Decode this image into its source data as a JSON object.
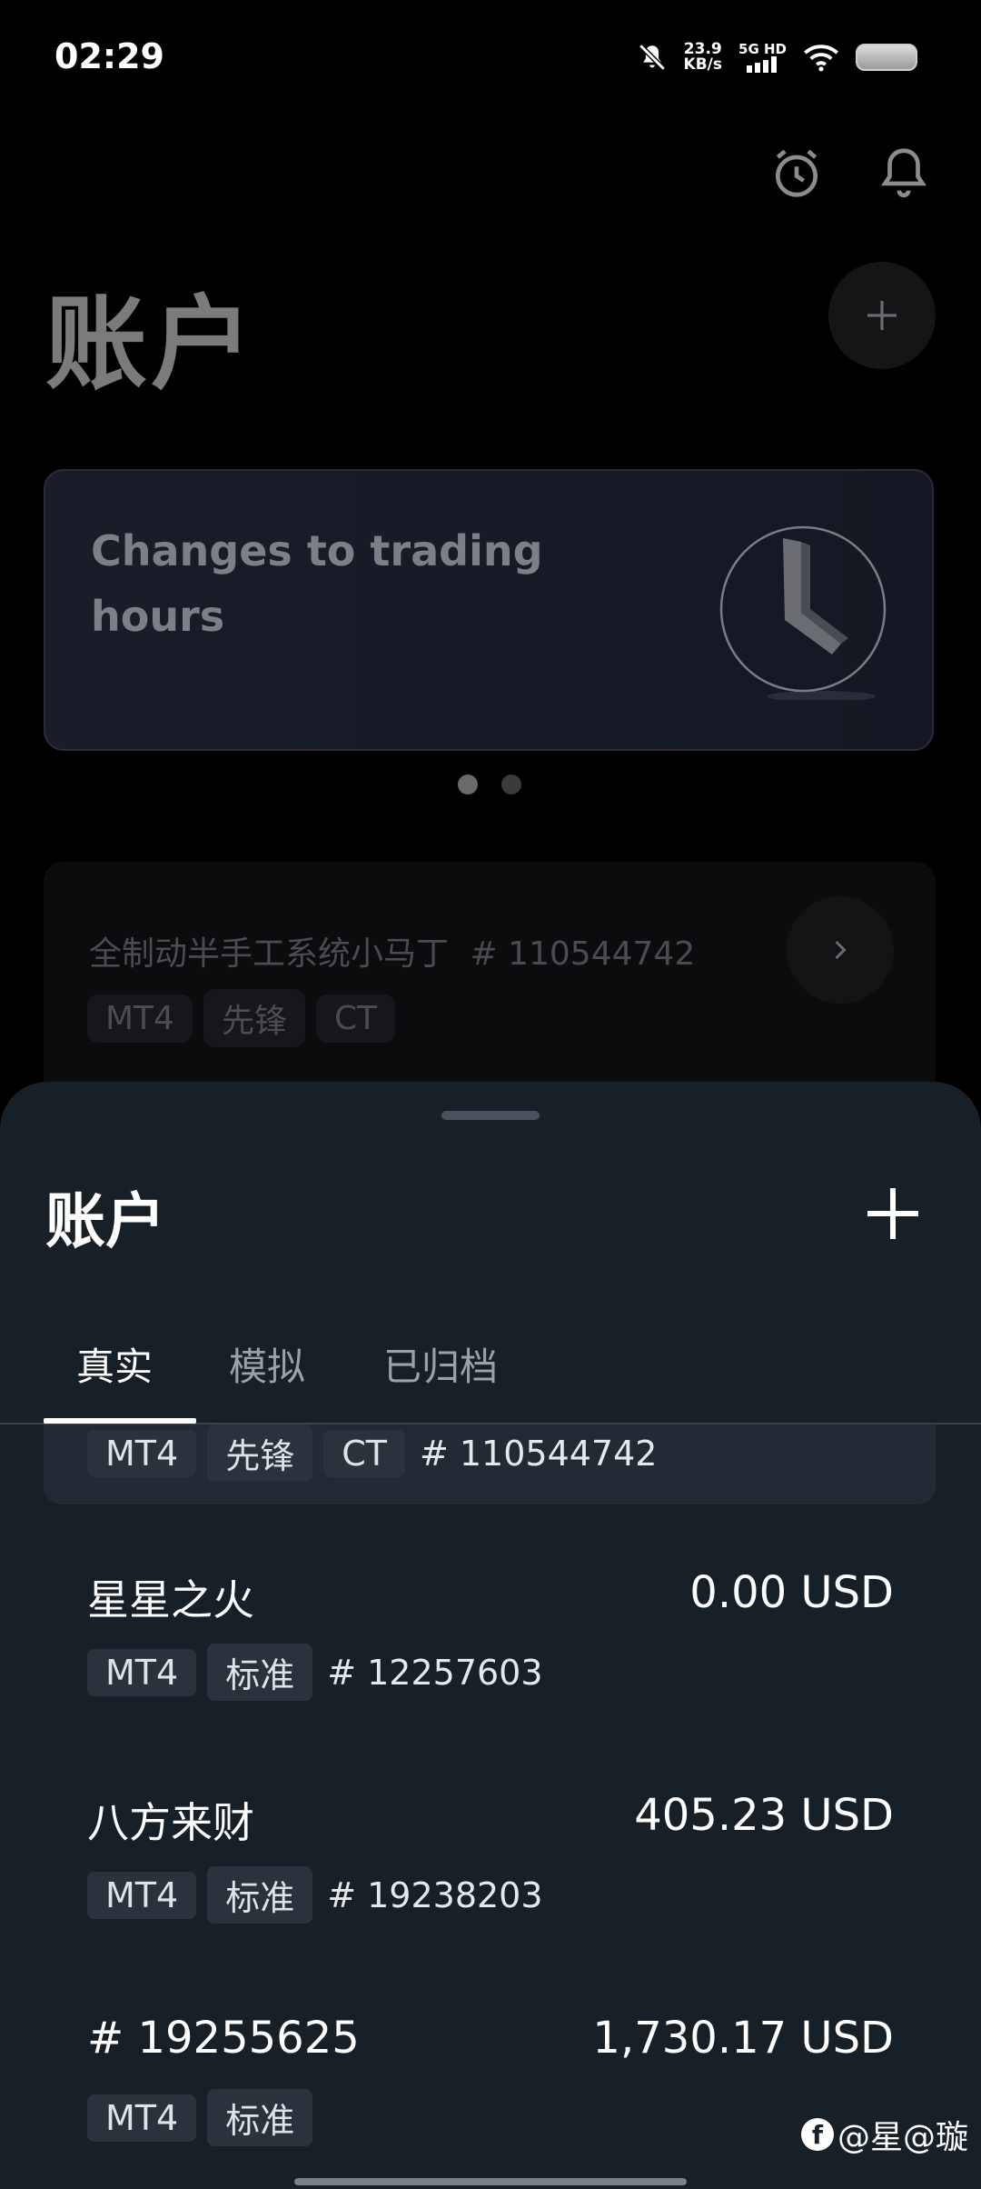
{
  "status": {
    "time": "02:29",
    "speed_value": "23.9",
    "speed_unit": "KB/s",
    "network": "5G HD"
  },
  "background": {
    "title": "账户",
    "banner_text": "Changes to trading hours",
    "account_card": {
      "name": "全制动半手工系统小马丁",
      "number": "# 110544742",
      "tags": [
        "MT4",
        "先锋",
        "CT"
      ]
    }
  },
  "sheet": {
    "title": "账户",
    "tabs": [
      {
        "label": "真实",
        "active": true
      },
      {
        "label": "模拟",
        "active": false
      },
      {
        "label": "已归档",
        "active": false
      }
    ],
    "partial_card": {
      "tags": [
        "MT4",
        "先锋",
        "CT"
      ],
      "number": "# 110544742"
    },
    "accounts": [
      {
        "name": "星星之火",
        "balance": "0.00 USD",
        "tags": [
          "MT4",
          "标准"
        ],
        "number": "# 12257603"
      },
      {
        "name": "八方来财",
        "balance": "405.23 USD",
        "tags": [
          "MT4",
          "标准"
        ],
        "number": "# 19238203"
      },
      {
        "name": "# 19255625",
        "balance": "1,730.17 USD",
        "tags": [
          "MT4",
          "标准"
        ],
        "number": ""
      }
    ]
  },
  "watermark": "@星@璇"
}
